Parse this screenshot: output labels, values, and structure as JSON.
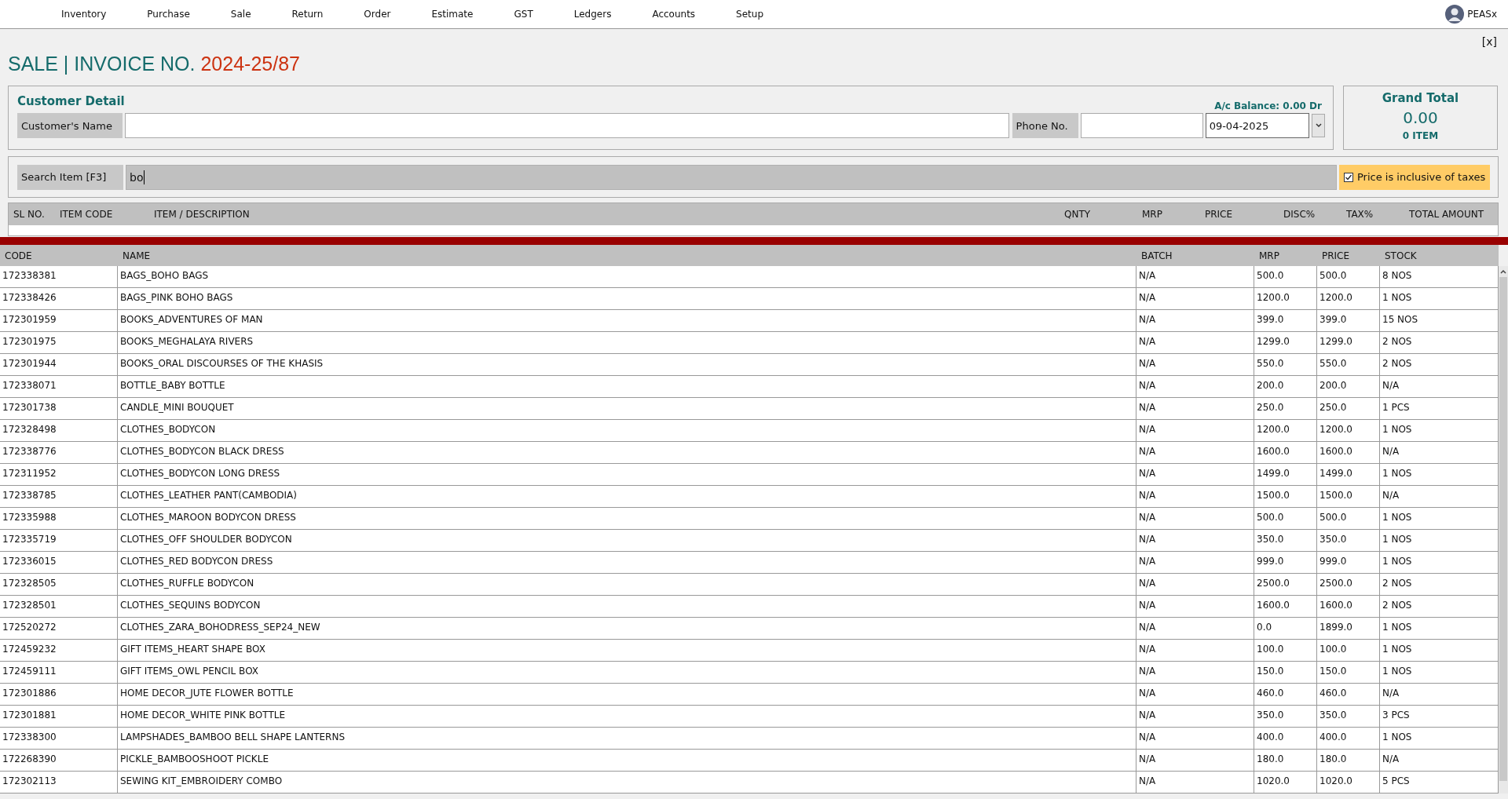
{
  "menu": [
    "Inventory",
    "Purchase",
    "Sale",
    "Return",
    "Order",
    "Estimate",
    "GST",
    "Ledgers",
    "Accounts",
    "Setup"
  ],
  "user": {
    "name": "PEASx"
  },
  "close_button": "[x]",
  "title": {
    "prefix": "SALE | INVOICE NO.",
    "invoice_no": "2024-25/87"
  },
  "customer_detail": {
    "heading": "Customer Detail",
    "balance": "A/c Balance: 0.00 Dr",
    "name_label": "Customer's Name",
    "phone_label": "Phone No.",
    "date": "09-04-2025"
  },
  "grand_total": {
    "heading": "Grand Total",
    "amount": "0.00",
    "items": "0 ITEM"
  },
  "search": {
    "label": "Search Item [F3]",
    "value": "bo",
    "price_inclusive": {
      "label": "Price is inclusive of taxes",
      "checked": true
    }
  },
  "invoice_table": {
    "columns": [
      "SL NO.",
      "ITEM CODE",
      "ITEM / DESCRIPTION",
      "QNTY",
      "MRP",
      "PRICE",
      "DISC%",
      "TAX%",
      "TOTAL AMOUNT"
    ]
  },
  "results": {
    "columns": [
      "CODE",
      "NAME",
      "BATCH",
      "MRP",
      "PRICE",
      "STOCK"
    ],
    "rows": [
      [
        "172338381",
        "BAGS_BOHO BAGS",
        "N/A",
        "500.0",
        "500.0",
        "8 NOS"
      ],
      [
        "172338426",
        "BAGS_PINK BOHO BAGS",
        "N/A",
        "1200.0",
        "1200.0",
        "1 NOS"
      ],
      [
        "172301959",
        "BOOKS_ADVENTURES OF MAN",
        "N/A",
        "399.0",
        "399.0",
        "15 NOS"
      ],
      [
        "172301975",
        "BOOKS_MEGHALAYA RIVERS",
        "N/A",
        "1299.0",
        "1299.0",
        "2 NOS"
      ],
      [
        "172301944",
        "BOOKS_ORAL DISCOURSES OF THE KHASIS",
        "N/A",
        "550.0",
        "550.0",
        "2 NOS"
      ],
      [
        "172338071",
        "BOTTLE_BABY BOTTLE",
        "N/A",
        "200.0",
        "200.0",
        "N/A"
      ],
      [
        "172301738",
        "CANDLE_MINI BOUQUET",
        "N/A",
        "250.0",
        "250.0",
        "1 PCS"
      ],
      [
        "172328498",
        "CLOTHES_BODYCON",
        "N/A",
        "1200.0",
        "1200.0",
        "1 NOS"
      ],
      [
        "172338776",
        "CLOTHES_BODYCON BLACK DRESS",
        "N/A",
        "1600.0",
        "1600.0",
        "N/A"
      ],
      [
        "172311952",
        "CLOTHES_BODYCON LONG DRESS",
        "N/A",
        "1499.0",
        "1499.0",
        "1 NOS"
      ],
      [
        "172338785",
        "CLOTHES_LEATHER PANT(CAMBODIA)",
        "N/A",
        "1500.0",
        "1500.0",
        "N/A"
      ],
      [
        "172335988",
        "CLOTHES_MAROON BODYCON DRESS",
        "N/A",
        "500.0",
        "500.0",
        "1 NOS"
      ],
      [
        "172335719",
        "CLOTHES_OFF SHOULDER BODYCON",
        "N/A",
        "350.0",
        "350.0",
        "1 NOS"
      ],
      [
        "172336015",
        "CLOTHES_RED BODYCON DRESS",
        "N/A",
        "999.0",
        "999.0",
        "1 NOS"
      ],
      [
        "172328505",
        "CLOTHES_RUFFLE BODYCON",
        "N/A",
        "2500.0",
        "2500.0",
        "2 NOS"
      ],
      [
        "172328501",
        "CLOTHES_SEQUINS BODYCON",
        "N/A",
        "1600.0",
        "1600.0",
        "2 NOS"
      ],
      [
        "172520272",
        "CLOTHES_ZARA_BOHODRESS_SEP24_NEW",
        "N/A",
        "0.0",
        "1899.0",
        "1 NOS"
      ],
      [
        "172459232",
        "GIFT ITEMS_HEART  SHAPE BOX",
        "N/A",
        "100.0",
        "100.0",
        "1 NOS"
      ],
      [
        "172459111",
        "GIFT ITEMS_OWL PENCIL BOX",
        "N/A",
        "150.0",
        "150.0",
        "1 NOS"
      ],
      [
        "172301886",
        "HOME DECOR_JUTE FLOWER BOTTLE",
        "N/A",
        "460.0",
        "460.0",
        "N/A"
      ],
      [
        "172301881",
        "HOME DECOR_WHITE PINK BOTTLE",
        "N/A",
        "350.0",
        "350.0",
        "3 PCS"
      ],
      [
        "172338300",
        "LAMPSHADES_BAMBOO BELL SHAPE LANTERNS",
        "N/A",
        "400.0",
        "400.0",
        "1 NOS"
      ],
      [
        "172268390",
        "PICKLE_BAMBOOSHOOT PICKLE",
        "N/A",
        "180.0",
        "180.0",
        "N/A"
      ],
      [
        "172302113",
        "SEWING KIT_EMBROIDERY COMBO",
        "N/A",
        "1020.0",
        "1020.0",
        "5 PCS"
      ]
    ]
  }
}
